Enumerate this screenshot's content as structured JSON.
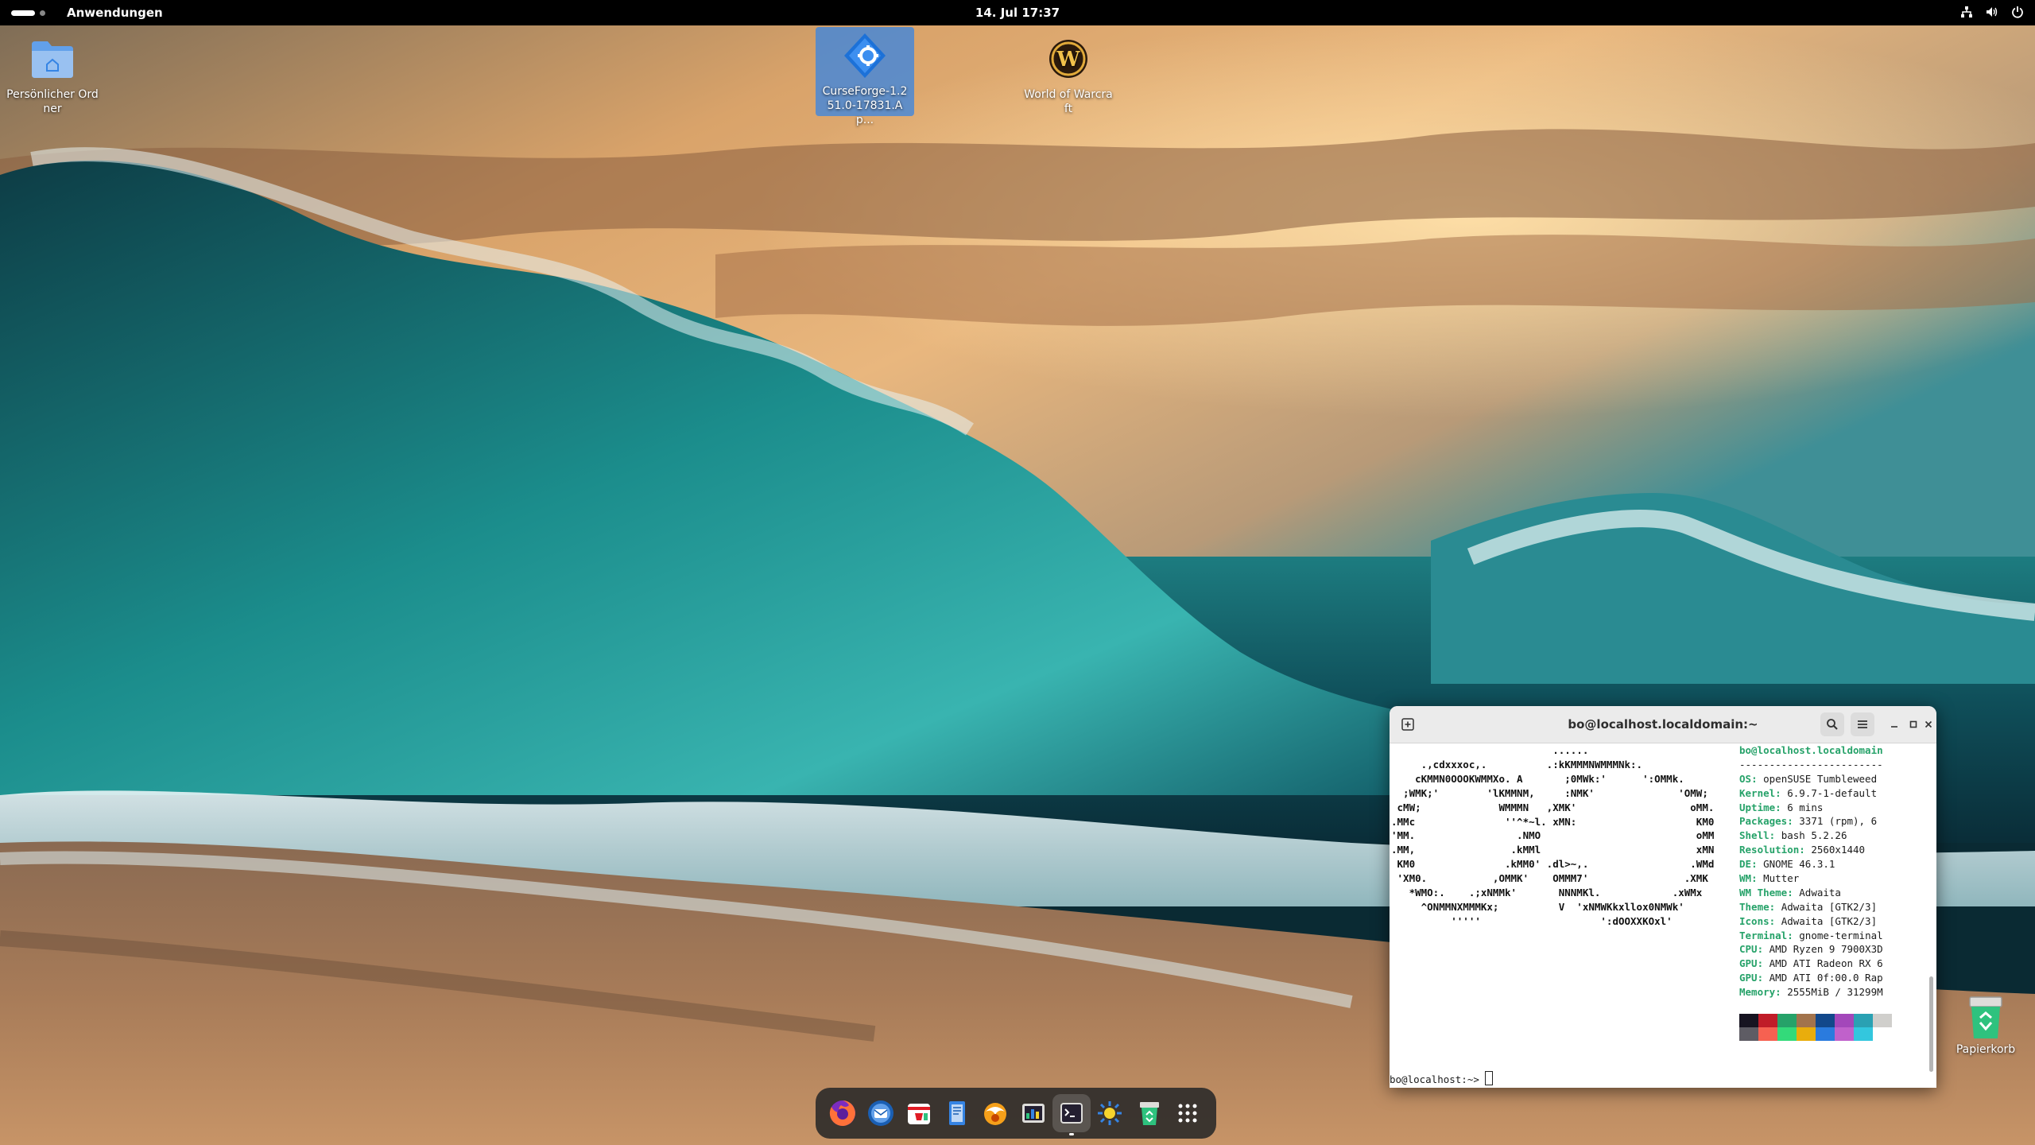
{
  "topbar": {
    "apps_menu": "Anwendungen",
    "clock": "14. Jul 17:37",
    "tray_icons": [
      "network-icon",
      "volume-icon",
      "power-icon"
    ]
  },
  "desktop": {
    "icons": [
      {
        "label": "Persönlicher Ordner",
        "icon": "home-folder-icon"
      },
      {
        "label": "CurseForge-1.2 51.0-17831.Ap...",
        "icon": "curseforge-icon"
      },
      {
        "label": "World of Warcraft",
        "icon": "wow-icon"
      }
    ],
    "trash": {
      "label": "Papierkorb",
      "icon": "trash-icon"
    }
  },
  "terminal": {
    "title": "bo@localhost.localdomain:~",
    "logo": "                           ......\n     .,cdxxxoc,.          .:kKMMMNWMMMNk:.\n    cKMMN0OOOKWMMXo. A       ;0MWk:'      ':OMMk.\n  ;WMK;'        'lKMMNM,     :NMK'              'OMW;\n cMW;             WMMMN   ,XMK'                   oMM.\n.MMc               ''^*~l. xMN:                    KM0\n'MM.                 .NMO                          oMM\n.MM,                .kMMl                          xMN\n KM0               .kMM0' .dl>~,.                 .WMd\n 'XM0.           ,OMMK'    OMMM7'                .XMK\n   *WMO:.    .;xNMMk'       NNNMKl.            .xWMx\n     ^ONMMNXMMMKx;          V  'xNMWKkxllox0NMWk'\n          '''''                    ':dOOXXKOxl'",
    "user_host": "bo@localhost.localdomain",
    "separator": "------------------------",
    "info": [
      {
        "key": "OS",
        "value": "openSUSE Tumbleweed"
      },
      {
        "key": "Kernel",
        "value": "6.9.7-1-default"
      },
      {
        "key": "Uptime",
        "value": "6 mins"
      },
      {
        "key": "Packages",
        "value": "3371 (rpm), 6"
      },
      {
        "key": "Shell",
        "value": "bash 5.2.26"
      },
      {
        "key": "Resolution",
        "value": "2560x1440"
      },
      {
        "key": "DE",
        "value": "GNOME 46.3.1"
      },
      {
        "key": "WM",
        "value": "Mutter"
      },
      {
        "key": "WM Theme",
        "value": "Adwaita"
      },
      {
        "key": "Theme",
        "value": "Adwaita [GTK2/3]"
      },
      {
        "key": "Icons",
        "value": "Adwaita [GTK2/3]"
      },
      {
        "key": "Terminal",
        "value": "gnome-terminal"
      },
      {
        "key": "CPU",
        "value": "AMD Ryzen 9 7900X3D"
      },
      {
        "key": "GPU",
        "value": "AMD ATI Radeon RX 6"
      },
      {
        "key": "GPU",
        "value": "AMD ATI 0f:00.0 Rap"
      },
      {
        "key": "Memory",
        "value": "2555MiB / 31299M"
      }
    ],
    "palette_row1": [
      "#171421",
      "#c01c28",
      "#26a269",
      "#a2734c",
      "#12488b",
      "#a347ba",
      "#2aa1b3",
      "#d0cfcc"
    ],
    "palette_row2": [
      "#5e5c64",
      "#f66151",
      "#33da7a",
      "#e9ad0c",
      "#2a7bde",
      "#c061cb",
      "#33c7de",
      "#ffffff"
    ],
    "prompt": "bo@localhost:~> "
  },
  "dock": {
    "items": [
      {
        "icon": "firefox-icon",
        "active": false
      },
      {
        "icon": "thunderbird-icon",
        "active": false
      },
      {
        "icon": "software-store-icon",
        "active": false
      },
      {
        "icon": "text-editor-icon",
        "active": false
      },
      {
        "icon": "lutris-icon",
        "active": false
      },
      {
        "icon": "system-monitor-icon",
        "active": false
      },
      {
        "icon": "terminal-icon",
        "active": true
      },
      {
        "icon": "settings-extension-icon",
        "active": false
      },
      {
        "icon": "trash-dock-icon",
        "active": false
      },
      {
        "icon": "app-grid-icon",
        "active": false
      }
    ]
  },
  "colors": {
    "accent": "#3584e4",
    "fastfetch_key": "#26a269"
  }
}
